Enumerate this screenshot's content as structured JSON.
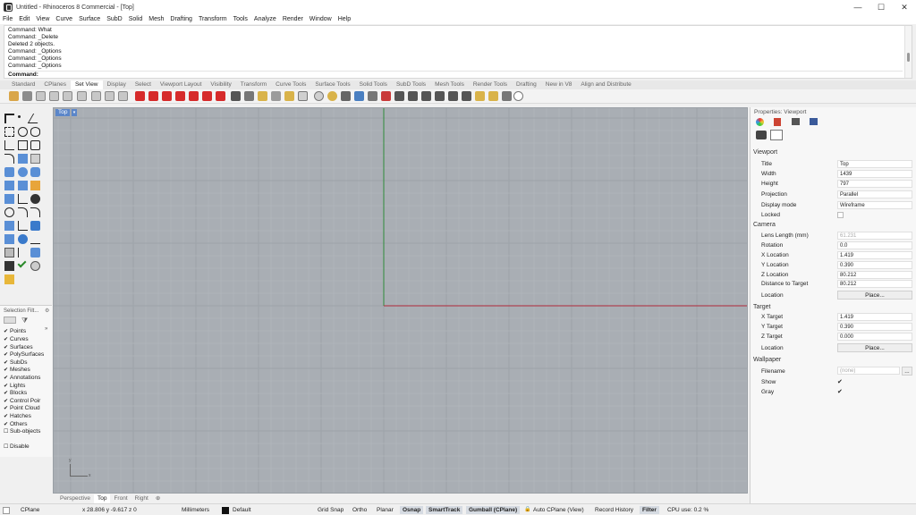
{
  "window": {
    "title": "Untitled - Rhinoceros 8 Commercial - [Top]",
    "minimize": "—",
    "maximize": "☐",
    "close": "✕"
  },
  "menu": [
    "File",
    "Edit",
    "View",
    "Curve",
    "Surface",
    "SubD",
    "Solid",
    "Mesh",
    "Drafting",
    "Transform",
    "Tools",
    "Analyze",
    "Render",
    "Window",
    "Help"
  ],
  "command_history": [
    "Command: What",
    "Command: _Delete",
    "Deleted 2 objects.",
    "Command: _Options",
    "Command: _Options",
    "Command: _Options"
  ],
  "command_prompt": "Command:",
  "toolbar_tabs": [
    "Standard",
    "CPlanes",
    "Set View",
    "Display",
    "Select",
    "Viewport Layout",
    "Visibility",
    "Transform",
    "Curve Tools",
    "Surface Tools",
    "Solid Tools",
    "SubD Tools",
    "Mesh Tools",
    "Render Tools",
    "Drafting",
    "New in V8",
    "Align and Distribute"
  ],
  "active_tab": "Set View",
  "viewport": {
    "label": "Top",
    "arrow": "▾",
    "axis_x": "x",
    "axis_y": "y"
  },
  "viewport_tabs": [
    "Perspective",
    "Top",
    "Front",
    "Right",
    "⊕"
  ],
  "selection_filter": {
    "title": "Selection Filt...",
    "items": [
      {
        "label": "Points",
        "checked": true
      },
      {
        "label": "Curves",
        "checked": true
      },
      {
        "label": "Surfaces",
        "checked": true
      },
      {
        "label": "PolySurfaces",
        "checked": true
      },
      {
        "label": "SubDs",
        "checked": true
      },
      {
        "label": "Meshes",
        "checked": true
      },
      {
        "label": "Annotations",
        "checked": true
      },
      {
        "label": "Lights",
        "checked": true
      },
      {
        "label": "Blocks",
        "checked": true
      },
      {
        "label": "Control Poir",
        "checked": true
      },
      {
        "label": "Point Cloud",
        "checked": true
      },
      {
        "label": "Hatches",
        "checked": true
      },
      {
        "label": "Others",
        "checked": true
      },
      {
        "label": "Sub-objects",
        "checked": false
      }
    ],
    "disable_label": "Disable"
  },
  "properties": {
    "title": "Properties: Viewport",
    "viewport_section": "Viewport",
    "title_label": "Title",
    "title_value": "Top",
    "width_label": "Width",
    "width_value": "1439",
    "height_label": "Height",
    "height_value": "797",
    "projection_label": "Projection",
    "projection_value": "Parallel",
    "display_mode_label": "Display mode",
    "display_mode_value": "Wireframe",
    "locked_label": "Locked",
    "camera_section": "Camera",
    "lens_label": "Lens Length (mm)",
    "lens_value": "61.231",
    "rotation_label": "Rotation",
    "rotation_value": "0.0",
    "x_location_label": "X Location",
    "x_location_value": "1.419",
    "y_location_label": "Y Location",
    "y_location_value": "0.390",
    "z_location_label": "Z Location",
    "z_location_value": "80.212",
    "distance_label": "Distance to Target",
    "distance_value": "80.212",
    "location_label": "Location",
    "place_label": "Place...",
    "target_section": "Target",
    "x_target_label": "X Target",
    "x_target_value": "1.419",
    "y_target_label": "Y Target",
    "y_target_value": "0.390",
    "z_target_label": "Z Target",
    "z_target_value": "0.000",
    "target_location_label": "Location",
    "target_place_label": "Place...",
    "wallpaper_section": "Wallpaper",
    "filename_label": "Filename",
    "filename_value": "(none)",
    "filename_browse": "...",
    "show_label": "Show",
    "gray_label": "Gray",
    "check": "✔"
  },
  "status": {
    "cplane": "CPlane",
    "coords": "x 28.806  y -9.617  z 0",
    "units": "Millimeters",
    "layer": "Default",
    "grid_snap": "Grid Snap",
    "ortho": "Ortho",
    "planar": "Planar",
    "osnap": "Osnap",
    "smarttrack": "SmartTrack",
    "gumball": "Gumball (CPlane)",
    "auto_cplane": "Auto CPlane (View)",
    "record_history": "Record History",
    "filter": "Filter",
    "cpu": "CPU use: 0.2 %"
  },
  "colors": {
    "viewport_bg": "#a9aeb4",
    "grid_minor": "#b5babf",
    "grid_major": "#9da3a9",
    "x_axis": "#b0283a",
    "y_axis": "#2e8b3a",
    "accent": "#5b86c9"
  }
}
